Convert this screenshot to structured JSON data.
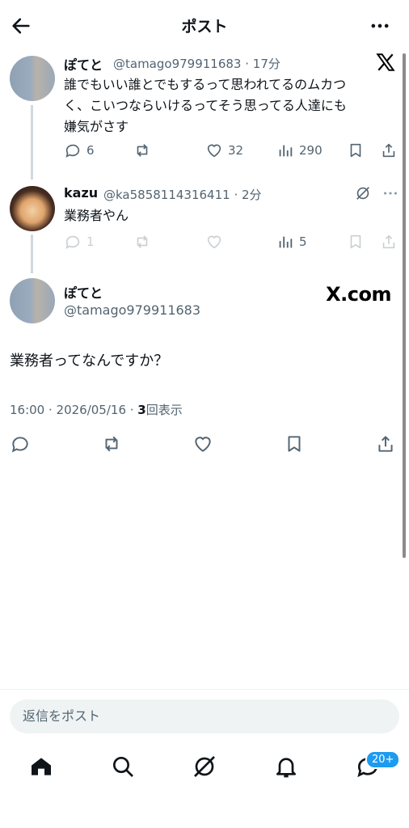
{
  "header": {
    "title": "ポスト"
  },
  "tweet1": {
    "name": "ぽてと",
    "handle_time": "@tamago979911683 · 17分",
    "text_line1": "誰でもいい誰とでもするって思われてるのムカつ",
    "text_line2": "く、こいつならいけるってそう思ってる人達にも",
    "text_line3": "嫌気がさす",
    "replies": "6",
    "likes": "32",
    "views": "290"
  },
  "tweet2": {
    "name": "kazu",
    "handle_time": "@ka5858114316411 · 2分",
    "text": "業務者やん",
    "replies": "1",
    "views": "5"
  },
  "main": {
    "name": "ぽてと",
    "handle": "@tamago979911683",
    "text": "業務者ってなんですか？",
    "meta_datetime": "16:00 · 2026/05/16 · ",
    "meta_count": "3",
    "meta_suffix": "回表示"
  },
  "watermark": {
    "xcom": "X.com"
  },
  "reply": {
    "placeholder": "返信をポスト"
  },
  "tabs": {
    "badge": "20+"
  },
  "colors": {
    "accent": "#1d9bf0",
    "secondary": "#536471"
  }
}
